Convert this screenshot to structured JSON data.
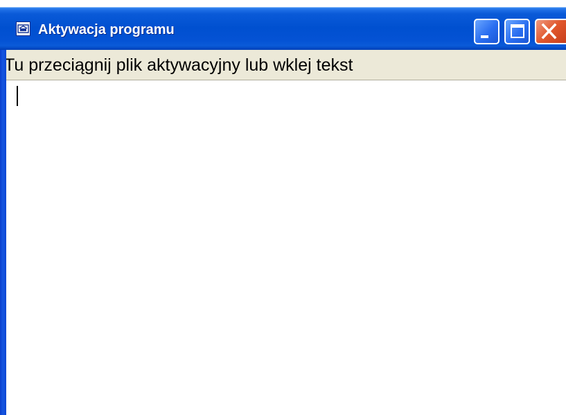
{
  "window": {
    "title": "Aktywacja programu",
    "icon": "app-window-icon"
  },
  "controls": {
    "minimize_icon": "minimize-icon",
    "maximize_icon": "maximize-icon",
    "close_icon": "close-icon"
  },
  "instruction": {
    "text": "Tu przeciągnij plik aktywacyjny lub wklej tekst"
  },
  "editor": {
    "value": ""
  },
  "colors": {
    "titlebar": "#0050d0",
    "label_background": "#ece9d8",
    "close_button": "#e0562c"
  }
}
